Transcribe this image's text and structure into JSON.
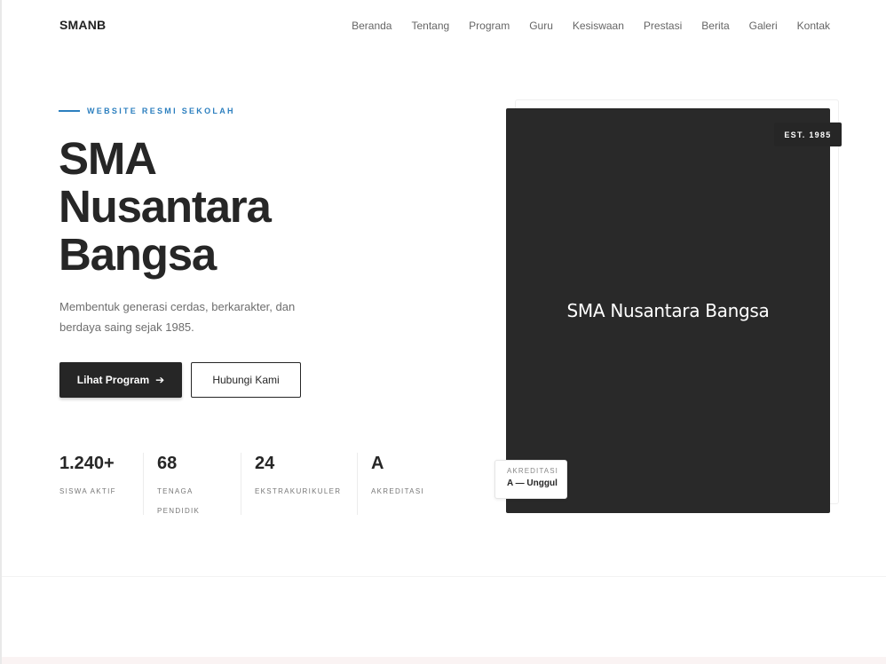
{
  "brand": "SMANB",
  "nav": {
    "items": [
      "Beranda",
      "Tentang",
      "Program",
      "Guru",
      "Kesiswaan",
      "Prestasi",
      "Berita",
      "Galeri",
      "Kontak"
    ]
  },
  "hero": {
    "eyebrow": "WEBSITE RESMI SEKOLAH",
    "title_lines": [
      "SMA",
      "Nusantara",
      "Bangsa"
    ],
    "description": "Membentuk generasi cerdas, berkarakter, dan berdaya saing sejak 1985.",
    "primary_button": "Lihat Program",
    "primary_button_icon": "arrow-right-icon",
    "secondary_button": "Hubungi Kami"
  },
  "stats": [
    {
      "value": "1.240+",
      "label": "SISWA AKTIF"
    },
    {
      "value": "68",
      "label": "TENAGA PENDIDIK"
    },
    {
      "value": "24",
      "label": "EKSTRAKURIKULER"
    },
    {
      "value": "A",
      "label": "AKREDITASI"
    }
  ],
  "card": {
    "title": "SMA Nusantara Bangsa",
    "est_badge": "EST. 1985",
    "accreditation_label": "AKREDITASI",
    "accreditation_value": "A — Unggul"
  },
  "colors": {
    "accent": "#2c7fbf",
    "dark": "#262626",
    "card": "#292929"
  }
}
